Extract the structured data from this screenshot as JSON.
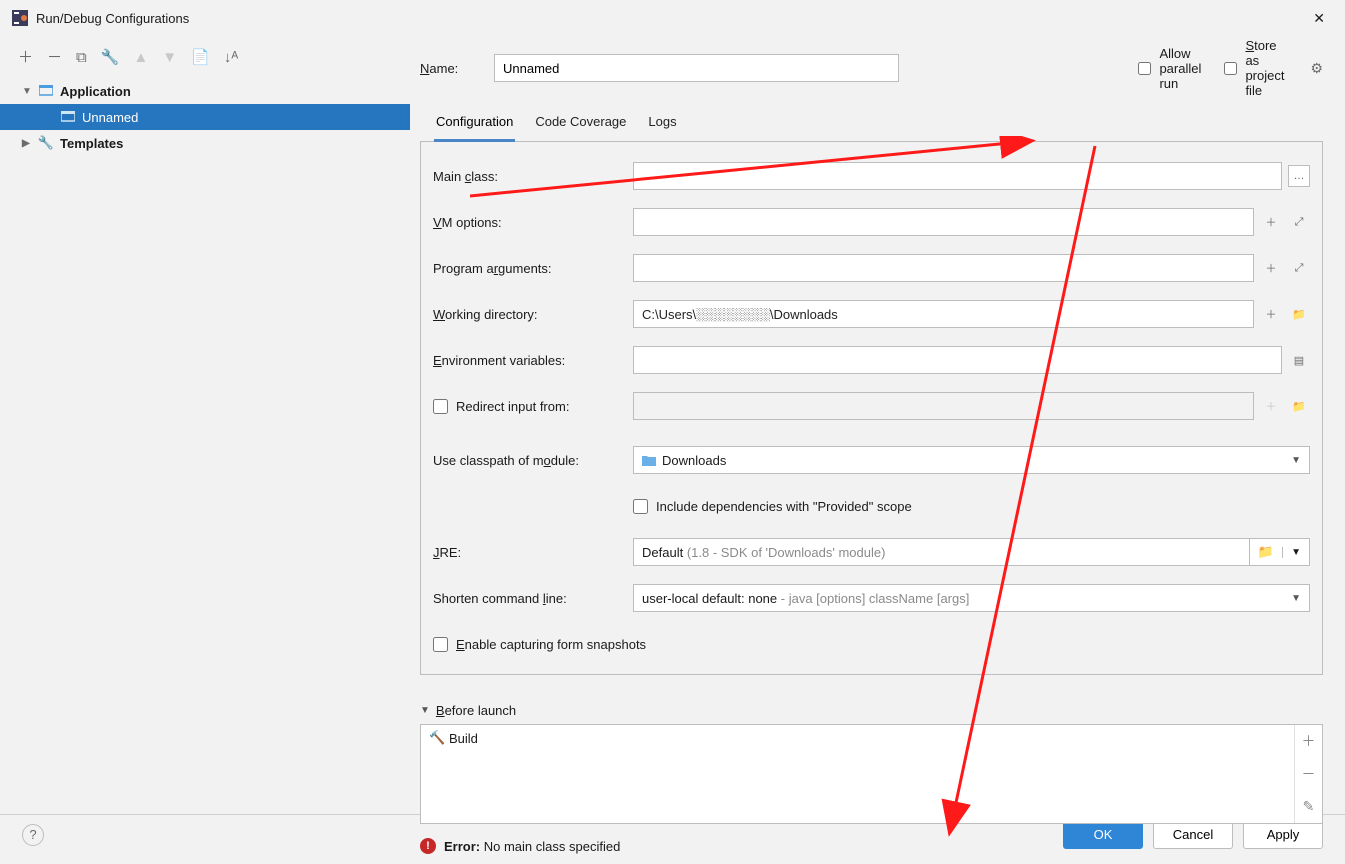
{
  "window": {
    "title": "Run/Debug Configurations"
  },
  "sidebar": {
    "groups": [
      {
        "label": "Application",
        "expanded": true,
        "children": [
          {
            "label": "Unnamed",
            "selected": true
          }
        ]
      },
      {
        "label": "Templates",
        "expanded": false
      }
    ]
  },
  "header": {
    "name_label": "Name:",
    "name_value": "Unnamed",
    "allow_parallel": "Allow parallel run",
    "store_as_project": "Store as project file"
  },
  "tabs": {
    "items": [
      "Configuration",
      "Code Coverage",
      "Logs"
    ],
    "active": 0
  },
  "form": {
    "main_class": {
      "label": "Main class:",
      "value": ""
    },
    "vm_options": {
      "label": "VM options:",
      "value": ""
    },
    "program_args": {
      "label": "Program arguments:",
      "value": ""
    },
    "working_dir": {
      "label": "Working directory:",
      "value": "C:\\Users\\░░░░░░░░\\Downloads"
    },
    "env_vars": {
      "label": "Environment variables:",
      "value": ""
    },
    "redirect_input": {
      "label": "Redirect input from:",
      "value": ""
    },
    "classpath": {
      "label": "Use classpath of module:",
      "value": "Downloads"
    },
    "include_provided": "Include dependencies with \"Provided\" scope",
    "jre": {
      "label": "JRE:",
      "prefix": "Default ",
      "hint": "(1.8 - SDK of 'Downloads' module)"
    },
    "shorten": {
      "label": "Shorten command line:",
      "prefix": "user-local default: none ",
      "hint": "- java [options] className [args]"
    },
    "enable_snapshots": "Enable capturing form snapshots"
  },
  "before_launch": {
    "header": "Before launch",
    "items": [
      "Build"
    ]
  },
  "error": {
    "label": "Error:",
    "message": "No main class specified"
  },
  "footer": {
    "ok": "OK",
    "cancel": "Cancel",
    "apply": "Apply"
  }
}
